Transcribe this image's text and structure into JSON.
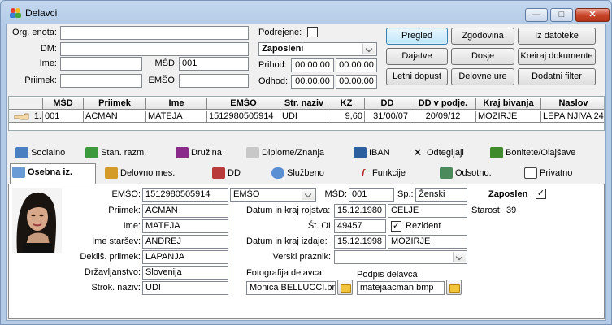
{
  "window": {
    "title": "Delavci",
    "minimize_glyph": "—",
    "maximize_glyph": "□",
    "close_glyph": "✕"
  },
  "filters": {
    "org_enota_label": "Org. enota:",
    "org_enota_value": "",
    "dm_label": "DM:",
    "dm_value": "",
    "ime_label": "Ime:",
    "ime_value": "",
    "msd_label": "MŠD:",
    "msd_value": "001",
    "priimek_label": "Priimek:",
    "priimek_value": "",
    "emso_label": "EMŠO:",
    "emso_value": "",
    "podrejene_label": "Podrejene:",
    "status_select": "Zaposleni",
    "prihod_label": "Prihod:",
    "prihod_from": "00.00.00",
    "prihod_to": "00.00.00",
    "odhod_label": "Odhod:",
    "odhod_from": "00.00.00",
    "odhod_to": "00.00.00"
  },
  "buttons": {
    "pregled": "Pregled",
    "zgodovina": "Zgodovina",
    "iz_datoteke": "Iz datoteke",
    "dajatve": "Dajatve",
    "dosje": "Dosje",
    "kreiraj_dokumente": "Kreiraj dokumente",
    "letni_dopust": "Letni dopust",
    "delovne_ure": "Delovne ure",
    "dodatni_filter": "Dodatni filter"
  },
  "grid": {
    "headers": [
      "MŠD",
      "Priimek",
      "Ime",
      "EMŠO",
      "Str. naziv",
      "KZ",
      "DD",
      "DD v podje.",
      "Kraj bivanja",
      "Naslov"
    ],
    "rows": [
      {
        "index": "1.",
        "cells": [
          "001",
          "ACMAN",
          "MATEJA",
          "1512980505914",
          "UDI",
          "9,60",
          "31/00/07",
          "20/09/12",
          "MOZIRJE",
          "LEPA NJIVA 24"
        ]
      }
    ]
  },
  "tabs_row1": [
    "Socialno",
    "Stan. razm.",
    "Družina",
    "Diplome/Znanja",
    "IBAN",
    "Odtegljaji",
    "Bonitete/Olajšave"
  ],
  "tabs_row2": [
    "Osebna iz.",
    "Delovno mes.",
    "DD",
    "Službeno",
    "Funkcije",
    "Odsotno.",
    "Privatno"
  ],
  "personal": {
    "emso_label": "EMŠO:",
    "emso_value": "1512980505914",
    "emso_type": "EMŠO",
    "priimek_label": "Priimek:",
    "priimek_value": "ACMAN",
    "ime_label": "Ime:",
    "ime_value": "MATEJA",
    "ime_starsev_label": "Ime staršev:",
    "ime_starsev_value": "ANDREJ",
    "deklis_label": "Dekliš. priimek:",
    "deklis_value": "LAPANJA",
    "drzavljanstvo_label": "Državljanstvo:",
    "drzavljanstvo_value": "Slovenija",
    "strok_label": "Strok. naziv:",
    "strok_value": "UDI",
    "msd_label": "MŠD:",
    "msd_value": "001",
    "sp_label": "Sp.:",
    "sp_value": "Ženski",
    "zaposlen_label": "Zaposlen",
    "rojstvo_label": "Datum in kraj rojstva:",
    "rojstvo_date": "15.12.1980",
    "rojstvo_kraj": "CELJE",
    "starost_label": "Starost:",
    "starost_value": "39",
    "st_oi_label": "Št. OI",
    "st_oi_value": "49457",
    "rezident_label": "Rezident",
    "izdaje_label": "Datum in kraj izdaje:",
    "izdaje_date": "15.12.1998",
    "izdaje_kraj": "MOZIRJE",
    "verski_label": "Verski praznik:",
    "verski_value": "",
    "foto_label": "Fotografija delavca:",
    "foto_value": "Monica BELLUCCI.bmp",
    "podpis_label": "Podpis delavca",
    "podpis_value": "matejaacman.bmp"
  },
  "colors": {
    "frame": "#b3cbe7",
    "panel": "#f0f0f0",
    "active_button": "#bee6fd",
    "close_button": "#c9462c"
  }
}
